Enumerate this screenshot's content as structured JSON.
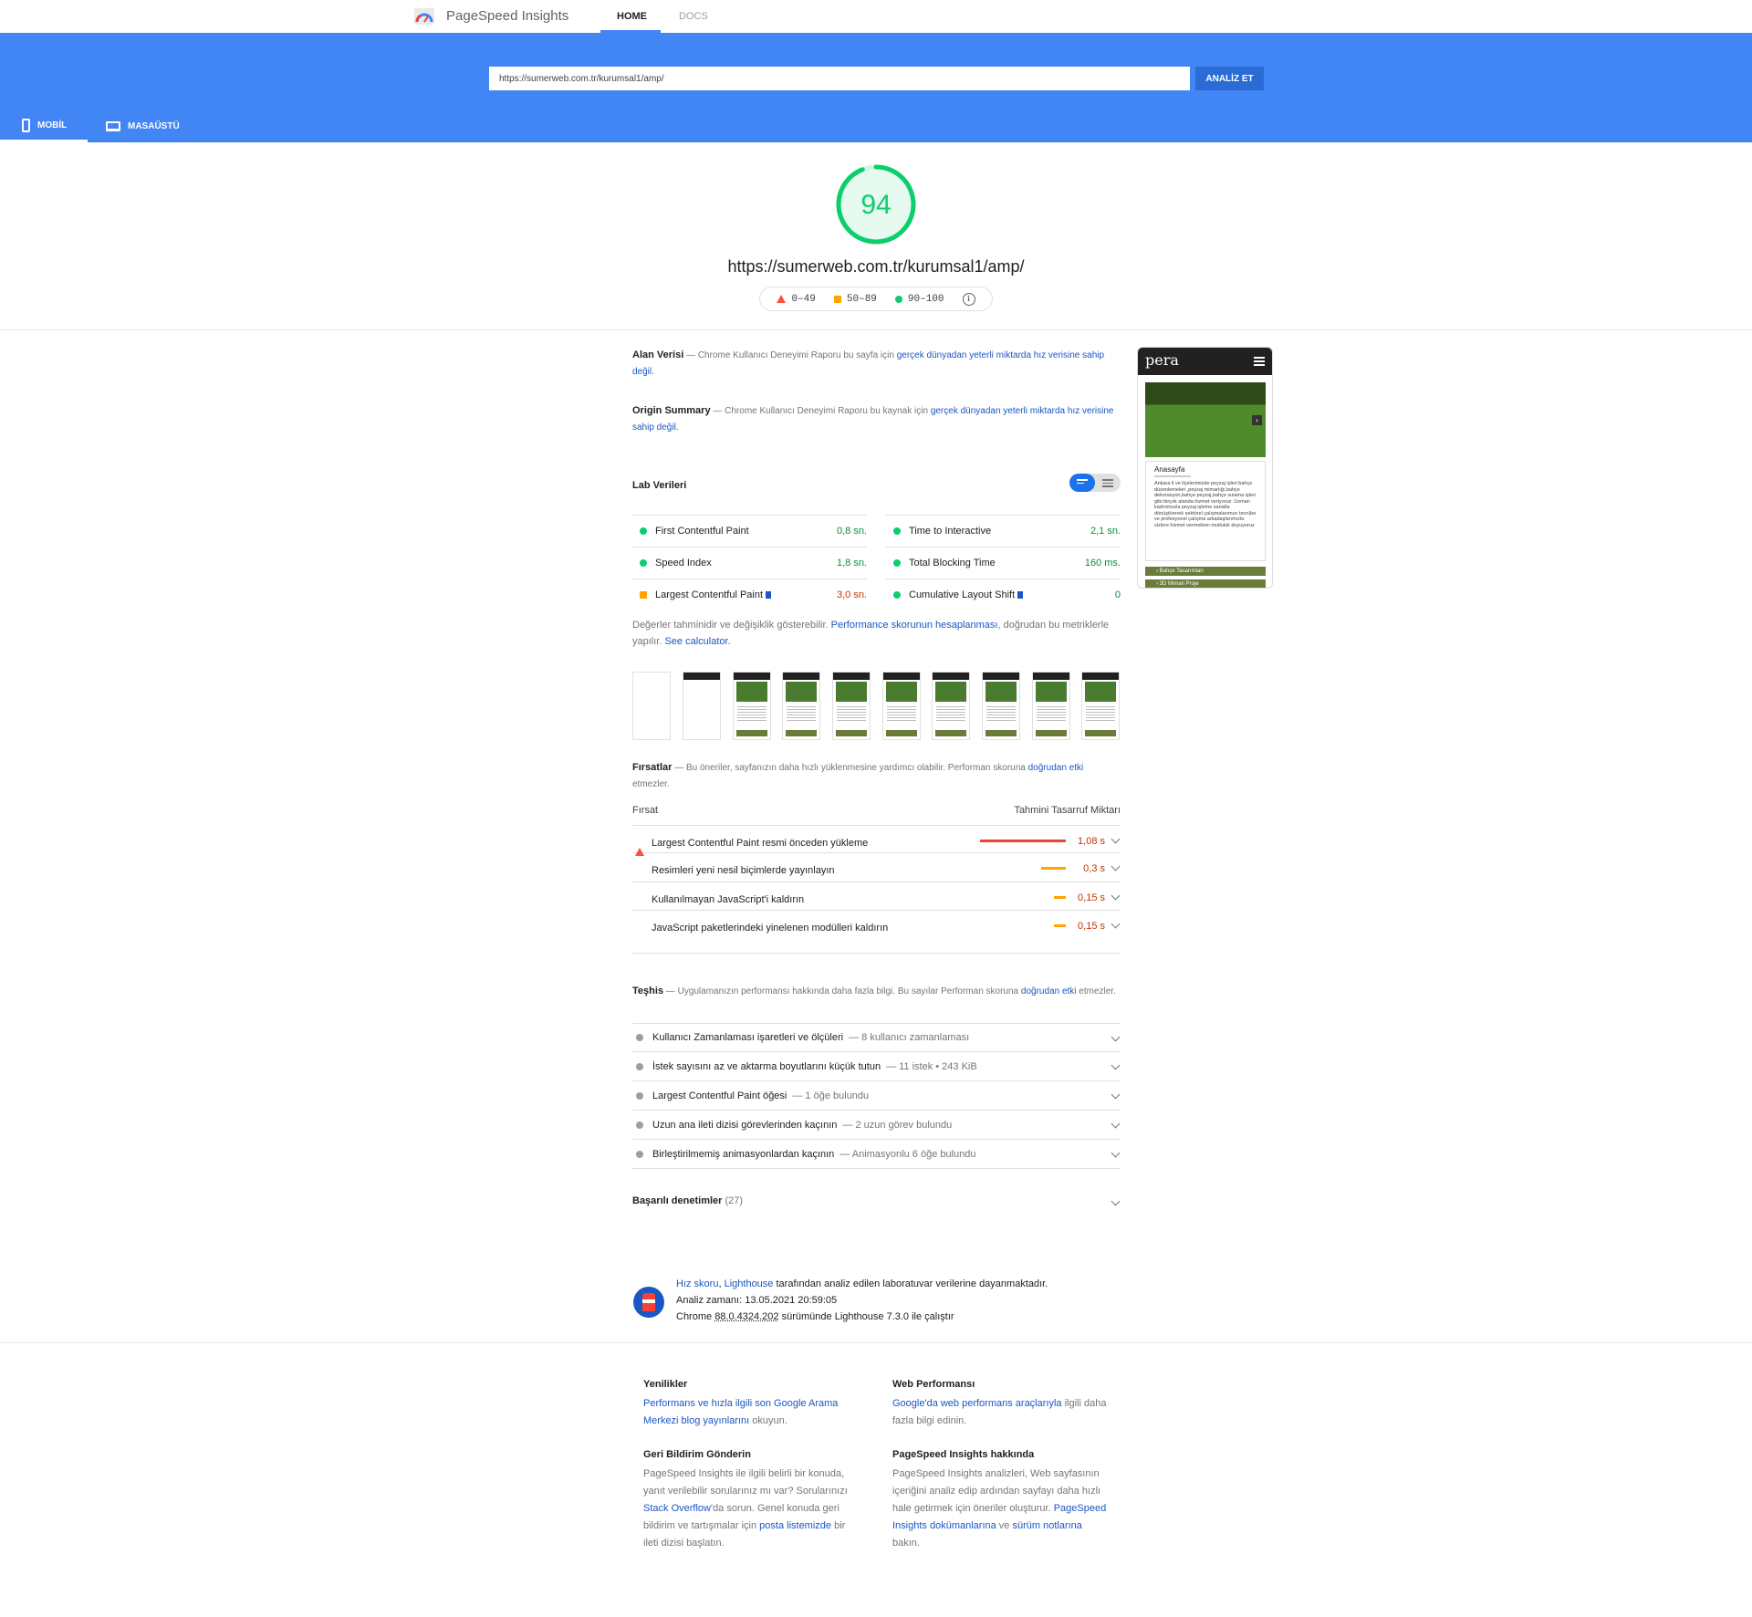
{
  "header": {
    "brand": "PageSpeed Insights",
    "tabs": [
      "HOME",
      "DOCS"
    ]
  },
  "search": {
    "url_value": "https://sumerweb.com.tr/kurumsal1/amp/",
    "analyze_label": "ANALİZ ET"
  },
  "device_tabs": {
    "mobile": "MOBİL",
    "desktop": "MASAÜSTÜ"
  },
  "score": {
    "value": "94",
    "fraction": 0.94,
    "url": "https://sumerweb.com.tr/kurumsal1/amp/",
    "legend": [
      "0–49",
      "50–89",
      "90–100"
    ],
    "colors": {
      "good": "#0cce6b",
      "average": "#ffa400",
      "fail": "#ff4e42"
    }
  },
  "field_data": {
    "title": "Alan Verisi",
    "text_prefix": "— Chrome Kullanıcı Deneyimi Raporu bu sayfa için",
    "link": "gerçek dünyadan yeterli miktarda hız verisine sahip değil."
  },
  "origin_summary": {
    "title": "Origin Summary",
    "text_prefix": "— Chrome Kullanıcı Deneyimi Raporu bu kaynak için",
    "link": "gerçek dünyadan yeterli miktarda hız verisine sahip değil."
  },
  "lab": {
    "title": "Lab Verileri",
    "metrics": [
      {
        "name": "First Contentful Paint",
        "value": "0,8 sn.",
        "status": "good"
      },
      {
        "name": "Time to Interactive",
        "value": "2,1 sn.",
        "status": "good"
      },
      {
        "name": "Speed Index",
        "value": "1,8 sn.",
        "status": "good"
      },
      {
        "name": "Total Blocking Time",
        "value": "160 ms.",
        "status": "good"
      },
      {
        "name": "Largest Contentful Paint",
        "value": "3,0 sn.",
        "status": "average"
      },
      {
        "name": "Cumulative Layout Shift",
        "value": "0",
        "status": "good"
      }
    ],
    "note_prefix": "Değerler tahminidir ve değişiklik gösterebilir.",
    "note_link": "Performance skorunun hesaplanması",
    "note_mid": ", doğrudan bu metriklerle yapılır.",
    "note_link2": "See calculator."
  },
  "opportunities": {
    "title": "Fırsatlar",
    "text": "— Bu öneriler, sayfanızın daha hızlı yüklenmesine yardımcı olabilir. Performan skoruna",
    "link": "doğrudan etki",
    "text_end": "etmezler.",
    "col_left": "Fırsat",
    "col_right": "Tahmini Tasarruf Miktarı",
    "items": [
      {
        "name": "Largest Contentful Paint resmi önceden yükleme",
        "value": "1,08 s",
        "status": "fail",
        "bar": 1.0
      },
      {
        "name": "Resimleri yeni nesil biçimlerde yayınlayın",
        "value": "0,3 s",
        "status": "average",
        "bar": 0.28
      },
      {
        "name": "Kullanılmayan JavaScript'i kaldırın",
        "value": "0,15 s",
        "status": "average",
        "bar": 0.14
      },
      {
        "name": "JavaScript paketlerindeki yinelenen modülleri kaldırın",
        "value": "0,15 s",
        "status": "average",
        "bar": 0.14
      }
    ]
  },
  "diagnostics": {
    "title": "Teşhis",
    "text": "— Uygulamanızın performansı hakkında daha fazla bilgi. Bu sayılar Performan skoruna",
    "link": "doğrudan etki",
    "text_end": "etmezler.",
    "items": [
      {
        "name": "Kullanıcı Zamanlaması işaretleri ve ölçüleri",
        "desc": "— 8 kullanıcı zamanlaması"
      },
      {
        "name": "İstek sayısını az ve aktarma boyutlarını küçük tutun",
        "desc": "— 11 istek • 243 KiB"
      },
      {
        "name": "Largest Contentful Paint öğesi",
        "desc": "— 1 öğe bulundu"
      },
      {
        "name": "Uzun ana ileti dizisi görevlerinden kaçının",
        "desc": "— 2 uzun görev bulundu"
      },
      {
        "name": "Birleştirilmemiş animasyonlardan kaçının",
        "desc": "— Animasyonlu 6 öğe bulundu"
      }
    ]
  },
  "passed": {
    "title": "Başarılı denetimler",
    "count": "(27)"
  },
  "preview": {
    "logo": "pera",
    "card_title": "Anasayfa",
    "card_text": "Ankara il ve ilçelerimizde peyzaj işleri bahçe düzenlemeleri ,peyzaj mimarlığı,bahçe dekorasyon,bahçe peyzaj,bahçe sulama işleri gibi birçok alanda hizmet veriyoruz. Uzman kadromuzla peyzaj işleme sanatla dönüştürerek sektörel çalışmalarımızı tecrübe ve profesyonel çalışma arkadaşlarımızla sizlere hizmet vermekten mutluluk duyuyoruz",
    "bar1": "› Bahçe Tasarımları",
    "bar2": "› 3D Mimari Proje"
  },
  "lighthouse_info": {
    "link1": "Hız skoru",
    "link2": "Lighthouse",
    "line1_rest": "tarafından analiz edilen laboratuvar verilerine dayanmaktadır.",
    "line2": "Analiz zamanı: 13.05.2021 20:59:05",
    "line3_prefix": "Chrome",
    "version": "88.0.4324.202",
    "line3_rest": "sürümünde Lighthouse 7.3.0 ile çalıştır"
  },
  "footer": {
    "news": {
      "title": "Yenilikler",
      "link": "Performans ve hızla ilgili son Google Arama Merkezi blog yayınlarını",
      "rest": "okuyun."
    },
    "webperf": {
      "title": "Web Performansı",
      "link": "Google'da web performans araçlarıyla",
      "rest": "ilgili daha fazla bilgi edinin."
    },
    "feedback": {
      "title": "Geri Bildirim Gönderin",
      "text1": "PageSpeed Insights ile ilgili belirli bir konuda, yanıt verilebilir sorularınız mı var? Sorularınızı",
      "link1": "Stack Overflow",
      "text2": "'da sorun. Genel konuda geri bildirim ve tartışmalar için",
      "link2": "posta listemizde",
      "text3": "bir ileti dizisi başlatın."
    },
    "about": {
      "title": "PageSpeed Insights hakkında",
      "text1": "PageSpeed Insights analizleri, Web sayfasının içeriğini analiz edip ardından sayfayı daha hızlı hale getirmek için öneriler oluşturur.",
      "link1": "PageSpeed Insights dokümanlarına",
      "text2": "ve",
      "link2": "sürüm notlarına",
      "text3": "bakın."
    }
  }
}
